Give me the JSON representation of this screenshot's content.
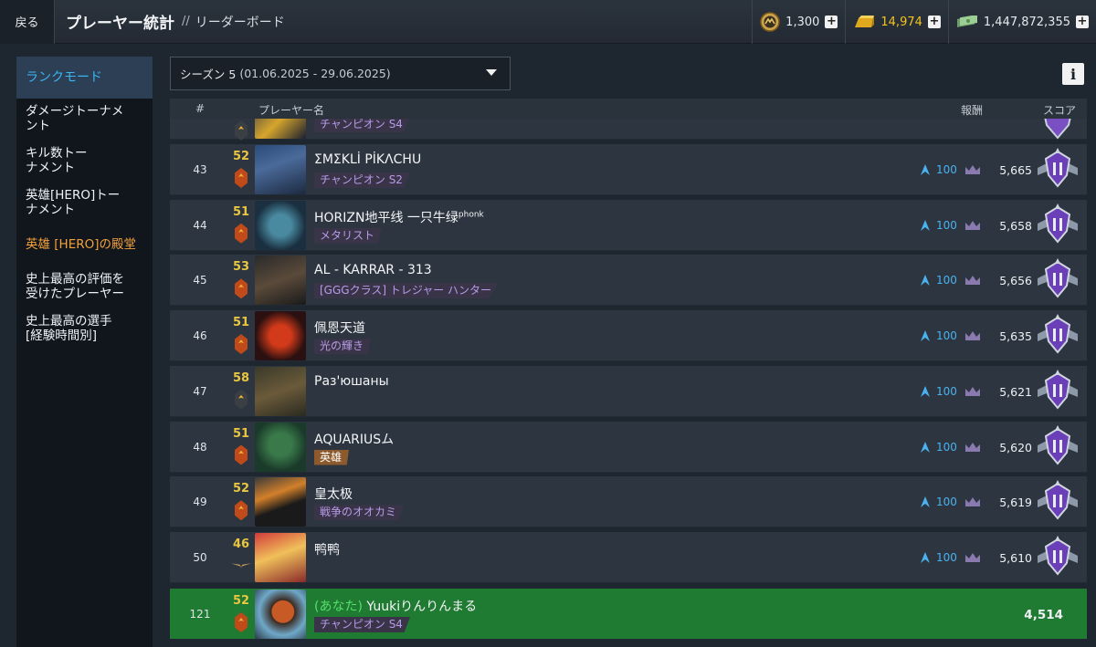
{
  "topbar": {
    "back_label": "戻る",
    "title": "プレーヤー統計",
    "separator": "//",
    "crumb": "リーダーボード"
  },
  "currencies": [
    {
      "icon": "medal-coin-icon",
      "value": "1,300"
    },
    {
      "icon": "gold-bar-icon",
      "value": "14,974",
      "color": "#f5c31f"
    },
    {
      "icon": "cash-icon",
      "value": "1,447,872,355"
    }
  ],
  "sidebar": {
    "items": [
      {
        "label": "ランクモード",
        "active": true
      },
      {
        "label": "ダメージトーナメント"
      },
      {
        "label": "キル数トーナメント"
      },
      {
        "label": "英雄[HERO]トーナメント"
      },
      {
        "label": "英雄 [HERO]の殿堂",
        "highlight": true
      },
      {
        "label": "史上最高の評価を受けたプレーヤー"
      },
      {
        "label": "史上最高の選手[経験時間別]"
      }
    ]
  },
  "season": {
    "label": "シーズン 5",
    "dates": "(01.06.2025 - 29.06.2025)"
  },
  "table": {
    "headers": {
      "rank": "#",
      "player": "プレーヤー名",
      "reward": "報酬",
      "score": "スコア"
    },
    "partial_row": {
      "tag": "チャンピオン S4"
    },
    "rows": [
      {
        "rank": "43",
        "level": "52",
        "name": "ΣMΣKLİ PİKΛCHU",
        "sup": "",
        "tag": "チャンピオン S2",
        "tag_type": "title",
        "reward": "100",
        "score": "5,665",
        "badge": "red"
      },
      {
        "rank": "44",
        "level": "51",
        "name": "HORIZN地平线 一只牛绿",
        "sup": "phonk",
        "tag": "メタリスト",
        "tag_type": "title",
        "reward": "100",
        "score": "5,658",
        "badge": "red"
      },
      {
        "rank": "45",
        "level": "53",
        "name": "AL - KARRAR - 313",
        "sup": "",
        "tag": "[GGGクラス] トレジャー ハンター",
        "tag_type": "title",
        "reward": "100",
        "score": "5,656",
        "badge": "red"
      },
      {
        "rank": "46",
        "level": "51",
        "name": "佩恩天道",
        "sup": "",
        "tag": "光の輝き",
        "tag_type": "title",
        "reward": "100",
        "score": "5,635",
        "badge": "red"
      },
      {
        "rank": "47",
        "level": "58",
        "name": "Раз'юшаны",
        "sup": "",
        "tag": "",
        "tag_type": "",
        "reward": "100",
        "score": "5,621",
        "badge": "dark"
      },
      {
        "rank": "48",
        "level": "51",
        "name": "AQUARIUSム",
        "sup": "",
        "tag": "英雄",
        "tag_type": "hero",
        "reward": "100",
        "score": "5,620",
        "badge": "red"
      },
      {
        "rank": "49",
        "level": "52",
        "name": "皇太极",
        "sup": "",
        "tag": "戦争のオオカミ",
        "tag_type": "title",
        "reward": "100",
        "score": "5,619",
        "badge": "red"
      },
      {
        "rank": "50",
        "level": "46",
        "name": "鸭鸭",
        "sup": "",
        "tag": "",
        "tag_type": "",
        "reward": "100",
        "score": "5,610",
        "badge": "wings"
      }
    ],
    "me": {
      "rank": "121",
      "level": "52",
      "you_label": "(あなた)",
      "name": "Yuukiりんりんまる",
      "tag": "チャンピオン S4",
      "score": "4,514"
    }
  },
  "colors": {
    "accent_blue": "#3ab4f2",
    "orange": "#f3a13b",
    "gold": "#e9c640",
    "me_row": "#1f7a32"
  }
}
